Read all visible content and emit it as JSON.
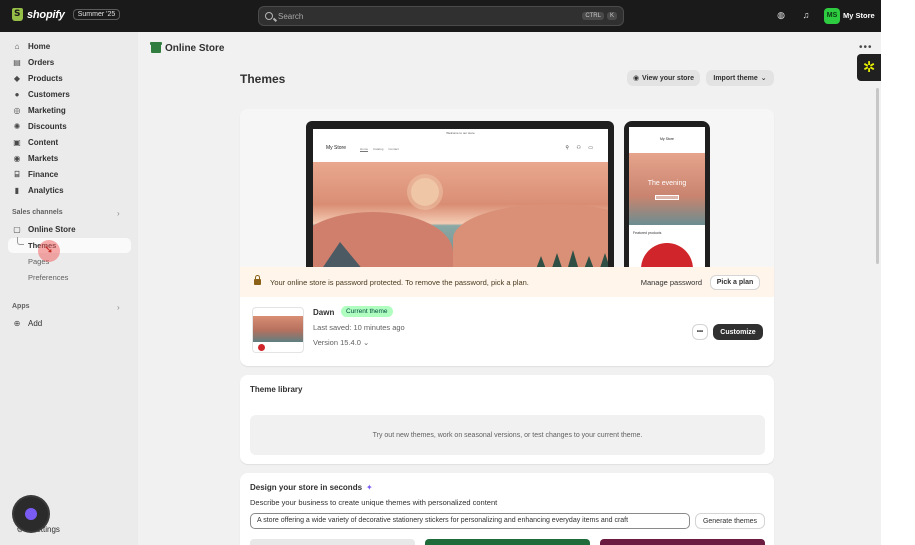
{
  "topbar": {
    "brand": "shopify",
    "edition": "Summer '25",
    "search_placeholder": "Search",
    "kbd_ctrl": "CTRL",
    "kbd_k": "K",
    "avatar_initials": "MS",
    "store_name": "My Store"
  },
  "sidebar": {
    "items": [
      {
        "label": "Home",
        "icon": "home-icon"
      },
      {
        "label": "Orders",
        "icon": "orders-icon"
      },
      {
        "label": "Products",
        "icon": "tag-icon"
      },
      {
        "label": "Customers",
        "icon": "person-icon"
      },
      {
        "label": "Marketing",
        "icon": "target-icon"
      },
      {
        "label": "Discounts",
        "icon": "discount-icon"
      },
      {
        "label": "Content",
        "icon": "content-icon"
      },
      {
        "label": "Markets",
        "icon": "globe-icon"
      },
      {
        "label": "Finance",
        "icon": "bank-icon"
      },
      {
        "label": "Analytics",
        "icon": "chart-icon"
      }
    ],
    "sales_channels_title": "Sales channels",
    "online_store": "Online Store",
    "sub_items": [
      "Themes",
      "Pages",
      "Preferences"
    ],
    "apps_title": "Apps",
    "add_label": "Add",
    "settings_label": "Settings"
  },
  "main": {
    "header_title": "Online Store",
    "page_title": "Themes",
    "view_store_label": "View your store",
    "import_theme_label": "Import theme",
    "preview": {
      "announcement": "Welcome to our store",
      "store_title": "My Store",
      "links": [
        "Home",
        "Catalog",
        "Contact"
      ],
      "phone_store_title": "My Store",
      "phone_hero_text": "The evening",
      "featured_label": "Featured products"
    },
    "banner": {
      "text": "Your online store is password protected. To remove the password, pick a plan.",
      "manage_password": "Manage password",
      "pick_plan": "Pick a plan"
    },
    "current_theme": {
      "name": "Dawn",
      "badge": "Current theme",
      "last_saved": "Last saved: 10 minutes ago",
      "version": "Version 15.4.0",
      "customize_label": "Customize",
      "more_label": "•••"
    },
    "library": {
      "title": "Theme library",
      "empty_text": "Try out new themes, work on seasonal versions, or test changes to your current theme."
    },
    "ai_design": {
      "title": "Design your store in seconds",
      "description": "Describe your business to create unique themes with personalized content",
      "input_value": "A store offering a wide variety of decorative stationery stickers for personalizing and enhancing everyday items and craft",
      "generate_label": "Generate themes"
    }
  },
  "colors": {
    "topbar_bg": "#1a1a1a",
    "sidebar_bg": "#ebebeb",
    "main_bg": "#f1f1f1",
    "badge_bg": "#affebf",
    "banner_bg": "#fff5ea",
    "primary_button": "#303030"
  }
}
